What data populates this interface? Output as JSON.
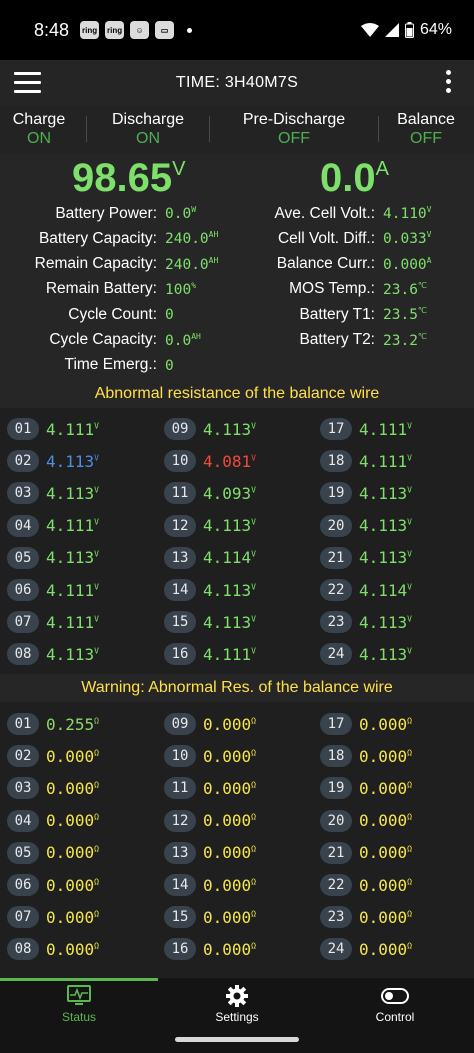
{
  "statusbar": {
    "time": "8:48",
    "notif1": "ring",
    "notif2": "ring",
    "battery": "64%"
  },
  "header": {
    "title": "TIME: 3H40M7S"
  },
  "switches": [
    {
      "label": "Charge",
      "value": "ON"
    },
    {
      "label": "Discharge",
      "value": "ON"
    },
    {
      "label": "Pre-Discharge",
      "value": "OFF"
    },
    {
      "label": "Balance",
      "value": "OFF"
    }
  ],
  "main": {
    "voltage": "98.65",
    "voltage_unit": "V",
    "current": "0.0",
    "current_unit": "A",
    "left": [
      {
        "label": "Battery Power:",
        "value": "0.0",
        "unit": "W"
      },
      {
        "label": "Battery Capacity:",
        "value": "240.0",
        "unit": "AH"
      },
      {
        "label": "Remain Capacity:",
        "value": "240.0",
        "unit": "AH"
      },
      {
        "label": "Remain Battery:",
        "value": "100",
        "unit": "%"
      },
      {
        "label": "Cycle Count:",
        "value": "0",
        "unit": ""
      },
      {
        "label": "Cycle Capacity:",
        "value": "0.0",
        "unit": "AH"
      },
      {
        "label": "Time Emerg.:",
        "value": "0",
        "unit": ""
      }
    ],
    "right": [
      {
        "label": "Ave. Cell Volt.:",
        "value": "4.110",
        "unit": "V"
      },
      {
        "label": "Cell Volt. Diff.:",
        "value": "0.033",
        "unit": "V"
      },
      {
        "label": "Balance Curr.:",
        "value": "0.000",
        "unit": "A"
      },
      {
        "label": "MOS Temp.:",
        "value": "23.6",
        "unit": "℃"
      },
      {
        "label": "Battery T1:",
        "value": "23.5",
        "unit": "℃"
      },
      {
        "label": "Battery T2:",
        "value": "23.2",
        "unit": "℃"
      }
    ]
  },
  "cells": {
    "title": "Abnormal resistance of the balance wire",
    "unit": "V",
    "items": [
      {
        "id": "01",
        "value": "4.111",
        "color": "green"
      },
      {
        "id": "02",
        "value": "4.113",
        "color": "blue"
      },
      {
        "id": "03",
        "value": "4.113",
        "color": "green"
      },
      {
        "id": "04",
        "value": "4.111",
        "color": "green"
      },
      {
        "id": "05",
        "value": "4.113",
        "color": "green"
      },
      {
        "id": "06",
        "value": "4.111",
        "color": "green"
      },
      {
        "id": "07",
        "value": "4.111",
        "color": "green"
      },
      {
        "id": "08",
        "value": "4.113",
        "color": "green"
      },
      {
        "id": "09",
        "value": "4.113",
        "color": "green"
      },
      {
        "id": "10",
        "value": "4.081",
        "color": "red"
      },
      {
        "id": "11",
        "value": "4.093",
        "color": "green"
      },
      {
        "id": "12",
        "value": "4.113",
        "color": "green"
      },
      {
        "id": "13",
        "value": "4.114",
        "color": "green"
      },
      {
        "id": "14",
        "value": "4.113",
        "color": "green"
      },
      {
        "id": "15",
        "value": "4.113",
        "color": "green"
      },
      {
        "id": "16",
        "value": "4.111",
        "color": "green"
      },
      {
        "id": "17",
        "value": "4.111",
        "color": "green"
      },
      {
        "id": "18",
        "value": "4.111",
        "color": "green"
      },
      {
        "id": "19",
        "value": "4.113",
        "color": "green"
      },
      {
        "id": "20",
        "value": "4.113",
        "color": "green"
      },
      {
        "id": "21",
        "value": "4.113",
        "color": "green"
      },
      {
        "id": "22",
        "value": "4.114",
        "color": "green"
      },
      {
        "id": "23",
        "value": "4.113",
        "color": "green"
      },
      {
        "id": "24",
        "value": "4.113",
        "color": "green"
      }
    ]
  },
  "resistance": {
    "title": "Warning: Abnormal Res. of the balance wire",
    "unit": "Ω",
    "items": [
      {
        "id": "01",
        "value": "0.255",
        "color": "resgreen"
      },
      {
        "id": "02",
        "value": "0.000",
        "color": "yellow"
      },
      {
        "id": "03",
        "value": "0.000",
        "color": "yellow"
      },
      {
        "id": "04",
        "value": "0.000",
        "color": "yellow"
      },
      {
        "id": "05",
        "value": "0.000",
        "color": "yellow"
      },
      {
        "id": "06",
        "value": "0.000",
        "color": "yellow"
      },
      {
        "id": "07",
        "value": "0.000",
        "color": "yellow"
      },
      {
        "id": "08",
        "value": "0.000",
        "color": "yellow"
      },
      {
        "id": "09",
        "value": "0.000",
        "color": "yellow"
      },
      {
        "id": "10",
        "value": "0.000",
        "color": "yellow"
      },
      {
        "id": "11",
        "value": "0.000",
        "color": "yellow"
      },
      {
        "id": "12",
        "value": "0.000",
        "color": "yellow"
      },
      {
        "id": "13",
        "value": "0.000",
        "color": "yellow"
      },
      {
        "id": "14",
        "value": "0.000",
        "color": "yellow"
      },
      {
        "id": "15",
        "value": "0.000",
        "color": "yellow"
      },
      {
        "id": "16",
        "value": "0.000",
        "color": "yellow"
      },
      {
        "id": "17",
        "value": "0.000",
        "color": "yellow"
      },
      {
        "id": "18",
        "value": "0.000",
        "color": "yellow"
      },
      {
        "id": "19",
        "value": "0.000",
        "color": "yellow"
      },
      {
        "id": "20",
        "value": "0.000",
        "color": "yellow"
      },
      {
        "id": "21",
        "value": "0.000",
        "color": "yellow"
      },
      {
        "id": "22",
        "value": "0.000",
        "color": "yellow"
      },
      {
        "id": "23",
        "value": "0.000",
        "color": "yellow"
      },
      {
        "id": "24",
        "value": "0.000",
        "color": "yellow"
      }
    ]
  },
  "nav": [
    {
      "label": "Status",
      "icon": "monitor-icon",
      "active": true
    },
    {
      "label": "Settings",
      "icon": "gear-icon",
      "active": false
    },
    {
      "label": "Control",
      "icon": "toggle-icon",
      "active": false
    }
  ],
  "colors": {
    "green": "#7ee06a",
    "accent": "#5bb84e",
    "warning": "#ffe047"
  }
}
